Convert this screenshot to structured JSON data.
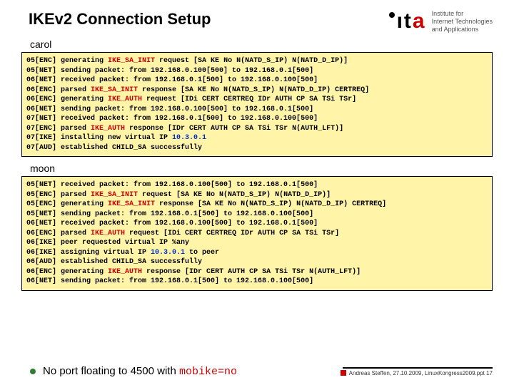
{
  "header": {
    "title": "IKEv2 Connection Setup",
    "logo_text": "ita",
    "logo_sub_l1": "Institute for",
    "logo_sub_l2": "Internet Technologies",
    "logo_sub_l3": "and Applications"
  },
  "section1": {
    "name": "carol"
  },
  "log1": [
    {
      "tag": "05[ENC]",
      "pre": " generating ",
      "hl": "IKE_SA_INIT",
      "post": " request [SA KE No N(NATD_S_IP) N(NATD_D_IP)]"
    },
    {
      "tag": "05[NET]",
      "pre": " sending packet: from 192.168.0.100[500] to 192.168.0.1[500]",
      "hl": "",
      "post": ""
    },
    {
      "tag": "06[NET]",
      "pre": " received packet: from 192.168.0.1[500] to 192.168.0.100[500]",
      "hl": "",
      "post": ""
    },
    {
      "tag": "06[ENC]",
      "pre": " parsed ",
      "hl": "IKE_SA_INIT",
      "post": " response [SA KE No N(NATD_S_IP) N(NATD_D_IP) CERTREQ]"
    },
    {
      "tag": "06[ENC]",
      "pre": " generating ",
      "hl": "IKE_AUTH",
      "post": " request [IDi CERT CERTREQ IDr AUTH CP SA TSi TSr]"
    },
    {
      "tag": "06[NET]",
      "pre": " sending packet: from 192.168.0.100[500] to 192.168.0.1[500]",
      "hl": "",
      "post": ""
    },
    {
      "tag": "07[NET]",
      "pre": " received packet: from 192.168.0.1[500] to 192.168.0.100[500]",
      "hl": "",
      "post": ""
    },
    {
      "tag": "07[ENC]",
      "pre": " parsed ",
      "hl": "IKE_AUTH",
      "post": " response [IDr CERT AUTH CP SA TSi TSr N(AUTH_LFT)]"
    },
    {
      "tag": "07[IKE]",
      "pre": " installing new virtual IP ",
      "hlb": "10.3.0.1",
      "post": ""
    },
    {
      "tag": "07[AUD]",
      "pre": " established CHILD_SA successfully",
      "hl": "",
      "post": ""
    }
  ],
  "section2": {
    "name": "moon"
  },
  "log2": [
    {
      "tag": "05[NET]",
      "pre": " received packet: from 192.168.0.100[500] to 192.168.0.1[500]",
      "hl": "",
      "post": ""
    },
    {
      "tag": "05[ENC]",
      "pre": " parsed ",
      "hl": "IKE_SA_INIT",
      "post": " request [SA KE No N(NATD_S_IP) N(NATD_D_IP)]"
    },
    {
      "tag": "05[ENC]",
      "pre": " generating ",
      "hl": "IKE_SA_INIT",
      "post": " response [SA KE No N(NATD_S_IP) N(NATD_D_IP) CERTREQ]"
    },
    {
      "tag": "05[NET]",
      "pre": " sending packet: from 192.168.0.1[500] to 192.168.0.100[500]",
      "hl": "",
      "post": ""
    },
    {
      "tag": "06[NET]",
      "pre": " received packet: from 192.168.0.100[500] to 192.168.0.1[500]",
      "hl": "",
      "post": ""
    },
    {
      "tag": "06[ENC]",
      "pre": " parsed ",
      "hl": "IKE_AUTH",
      "post": " request [IDi CERT CERTREQ IDr AUTH CP SA TSi TSr]"
    },
    {
      "tag": "06[IKE]",
      "pre": " peer requested virtual IP %any",
      "hl": "",
      "post": ""
    },
    {
      "tag": "06[IKE]",
      "pre": " assigning virtual IP ",
      "hlb": "10.3.0.1",
      "post": " to peer"
    },
    {
      "tag": "06[AUD]",
      "pre": " established CHILD_SA successfully",
      "hl": "",
      "post": ""
    },
    {
      "tag": "06[ENC]",
      "pre": " generating ",
      "hl": "IKE_AUTH",
      "post": " response [IDr CERT AUTH CP SA TSi TSr N(AUTH_LFT)]"
    },
    {
      "tag": "06[NET]",
      "pre": " sending packet: from 192.168.0.1[500] to 192.168.0.100[500]",
      "hl": "",
      "post": ""
    }
  ],
  "footer": {
    "bullet_text_pre": "No port floating to 4500 with ",
    "bullet_text_hl": "mobike=no",
    "citation": "Andreas Steffen, 27.10.2009, LinuxKongress2009.ppt 17"
  }
}
